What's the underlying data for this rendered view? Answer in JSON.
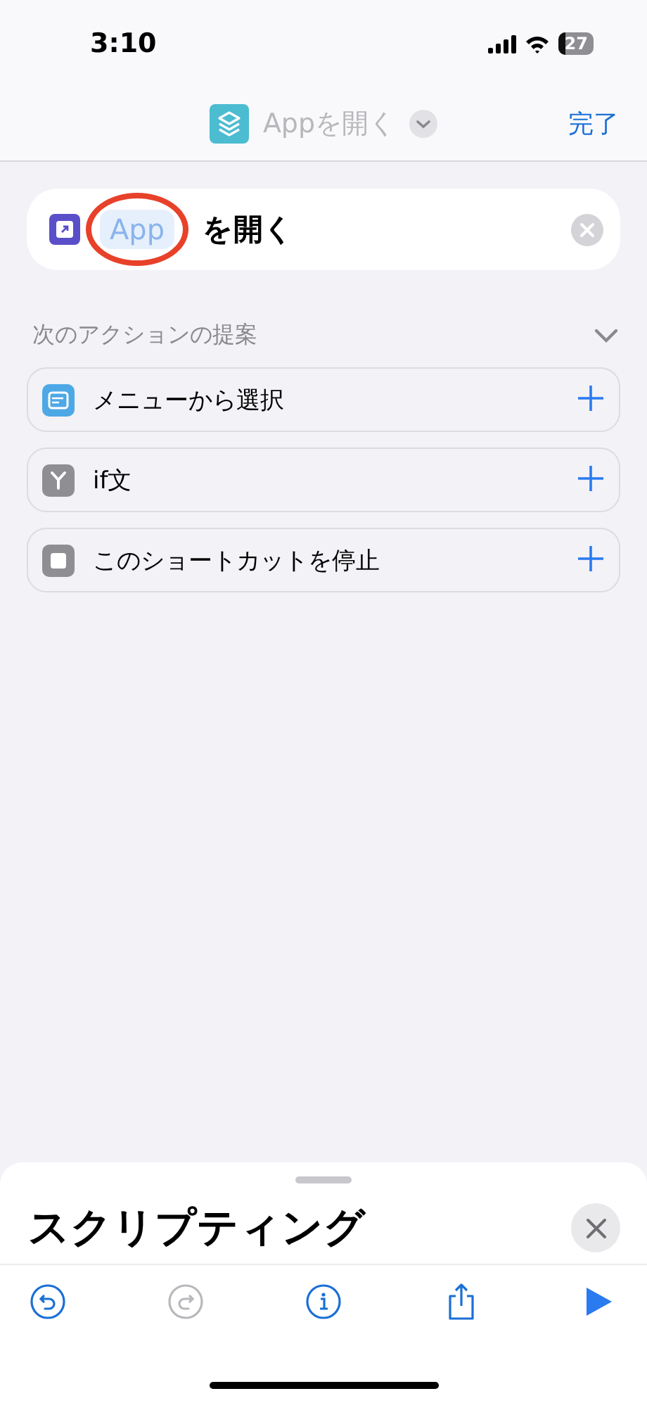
{
  "status_bar": {
    "time": "3:10",
    "battery": "27"
  },
  "nav": {
    "title": "Appを開く",
    "done": "完了"
  },
  "action": {
    "parameter": "App",
    "text": "を開く",
    "annotated": true
  },
  "suggestions": {
    "title": "次のアクションの提案",
    "expanded": true,
    "items": [
      {
        "label": "メニューから選択",
        "kind": "menu"
      },
      {
        "label": "if文",
        "kind": "if"
      },
      {
        "label": "このショートカットを停止",
        "kind": "stop"
      }
    ]
  },
  "sheet": {
    "title": "スクリプティング"
  },
  "toolbar": [
    {
      "kind": "undo",
      "disabled": false
    },
    {
      "kind": "redo",
      "disabled": true
    },
    {
      "kind": "info",
      "disabled": false
    },
    {
      "kind": "share",
      "disabled": false
    },
    {
      "kind": "run",
      "disabled": false
    }
  ]
}
